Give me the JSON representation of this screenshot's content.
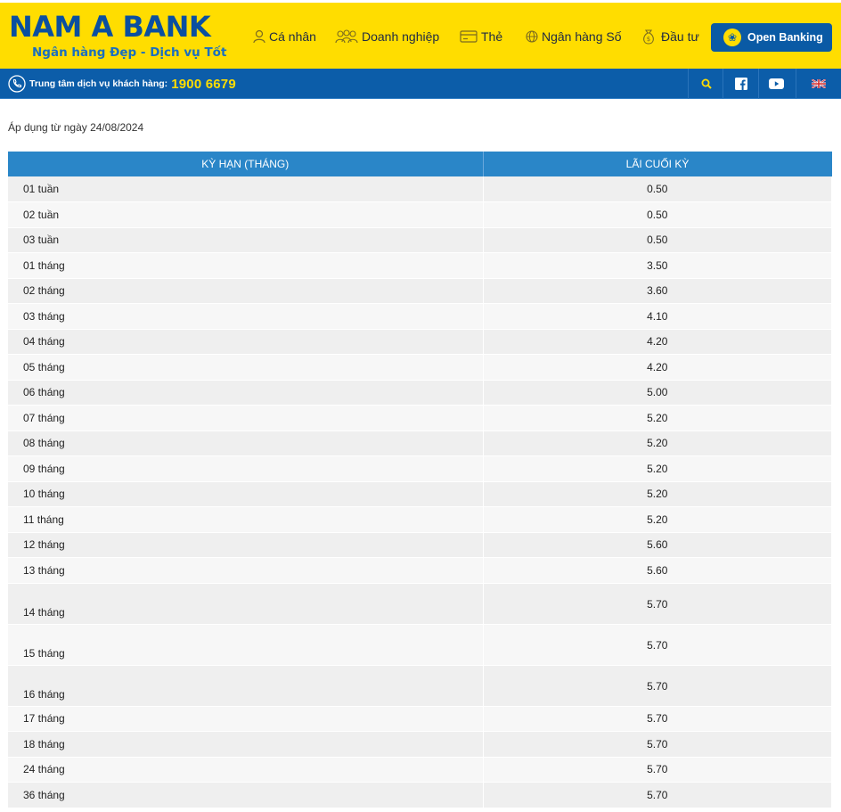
{
  "brand": {
    "title": "NAM A BANK",
    "tagline": "Ngân hàng Đẹp - Dịch vụ Tốt",
    "colors": {
      "yellow": "#ffdd00",
      "blue": "#0c5da9",
      "table_header": "#2a86c8"
    }
  },
  "nav": {
    "items": [
      {
        "label": "Cá nhân",
        "icon": "person-icon"
      },
      {
        "label": "Doanh nghiệp",
        "icon": "group-icon"
      },
      {
        "label": "Thẻ",
        "icon": "card-icon"
      },
      {
        "label": "Ngân hàng Số",
        "icon": "globe-icon"
      },
      {
        "label": "Đầu tư",
        "icon": "money-bag-icon"
      }
    ],
    "open_banking": "Open Banking"
  },
  "hotline": {
    "label": "Trung tâm dịch vụ khách hàng:",
    "number": "1900 6679"
  },
  "content": {
    "apply_date": "Áp dụng từ ngày 24/08/2024",
    "table": {
      "headers": [
        "KỲ HẠN (THÁNG)",
        "LÃI CUỐI KỲ"
      ],
      "rows": [
        {
          "term": "01 tuần",
          "rate": "0.50"
        },
        {
          "term": "02 tuần",
          "rate": "0.50"
        },
        {
          "term": "03 tuần",
          "rate": "0.50"
        },
        {
          "term": "01 tháng",
          "rate": "3.50"
        },
        {
          "term": "02 tháng",
          "rate": "3.60"
        },
        {
          "term": "03 tháng",
          "rate": "4.10"
        },
        {
          "term": "04 tháng",
          "rate": "4.20"
        },
        {
          "term": "05 tháng",
          "rate": "4.20"
        },
        {
          "term": "06 tháng",
          "rate": "5.00"
        },
        {
          "term": "07 tháng",
          "rate": "5.20"
        },
        {
          "term": "08 tháng",
          "rate": "5.20"
        },
        {
          "term": "09 tháng",
          "rate": "5.20"
        },
        {
          "term": "10 tháng",
          "rate": "5.20"
        },
        {
          "term": "11 tháng",
          "rate": "5.20"
        },
        {
          "term": "12 tháng",
          "rate": "5.60"
        },
        {
          "term": "13 tháng",
          "rate": "5.60"
        },
        {
          "term": "14 tháng",
          "rate": "5.70"
        },
        {
          "term": "15 tháng",
          "rate": "5.70"
        },
        {
          "term": "16 tháng",
          "rate": "5.70"
        },
        {
          "term": "17 tháng",
          "rate": "5.70"
        },
        {
          "term": "18 tháng",
          "rate": "5.70"
        },
        {
          "term": "24 tháng",
          "rate": "5.70"
        },
        {
          "term": "36 tháng",
          "rate": "5.70"
        }
      ]
    }
  }
}
